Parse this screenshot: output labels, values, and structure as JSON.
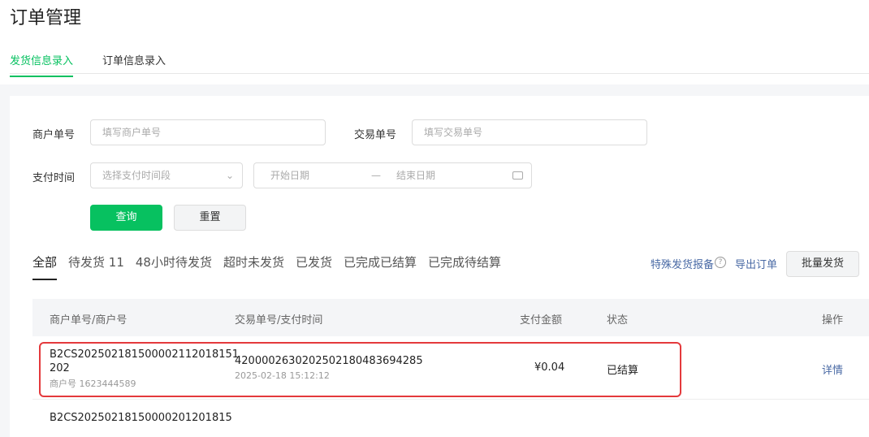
{
  "title": "订单管理",
  "tabs": [
    "发货信息录入",
    "订单信息录入"
  ],
  "form": {
    "merchant_no_label": "商户单号",
    "merchant_no_placeholder": "填写商户单号",
    "trade_no_label": "交易单号",
    "trade_no_placeholder": "填写交易单号",
    "pay_time_label": "支付时间",
    "pay_time_placeholder": "选择支付时间段",
    "start_date": "开始日期",
    "date_sep": "—",
    "end_date": "结束日期",
    "query": "查询",
    "reset": "重置"
  },
  "filter_tabs": [
    "全部",
    "待发货 11",
    "48小时待发货",
    "超时未发货",
    "已发货",
    "已完成已结算",
    "已完成待结算"
  ],
  "actions": {
    "special": "特殊发货报备",
    "export": "导出订单",
    "batch": "批量发货"
  },
  "table": {
    "headers": [
      "商户单号/商户号",
      "交易单号/支付时间",
      "支付金额",
      "状态",
      "操作"
    ],
    "rows": [
      {
        "merchant_order": "B2CS20250218150000211201815 1202",
        "merchant_order_l1": "B2CS202502181500002112018151",
        "merchant_order_l2": "202",
        "merchant_id": "商户号 1623444589",
        "trade_no": "4200002630202502180483694285",
        "pay_time": "2025-02-18 15:12:12",
        "amount": "¥0.04",
        "status": "已结算",
        "action": "详情"
      },
      {
        "merchant_order_l1": "B2CS20250218150000201201815"
      }
    ]
  },
  "colors": {
    "accent": "#07c160",
    "link": "#4a6aa5",
    "highlight": "#e4393c"
  }
}
